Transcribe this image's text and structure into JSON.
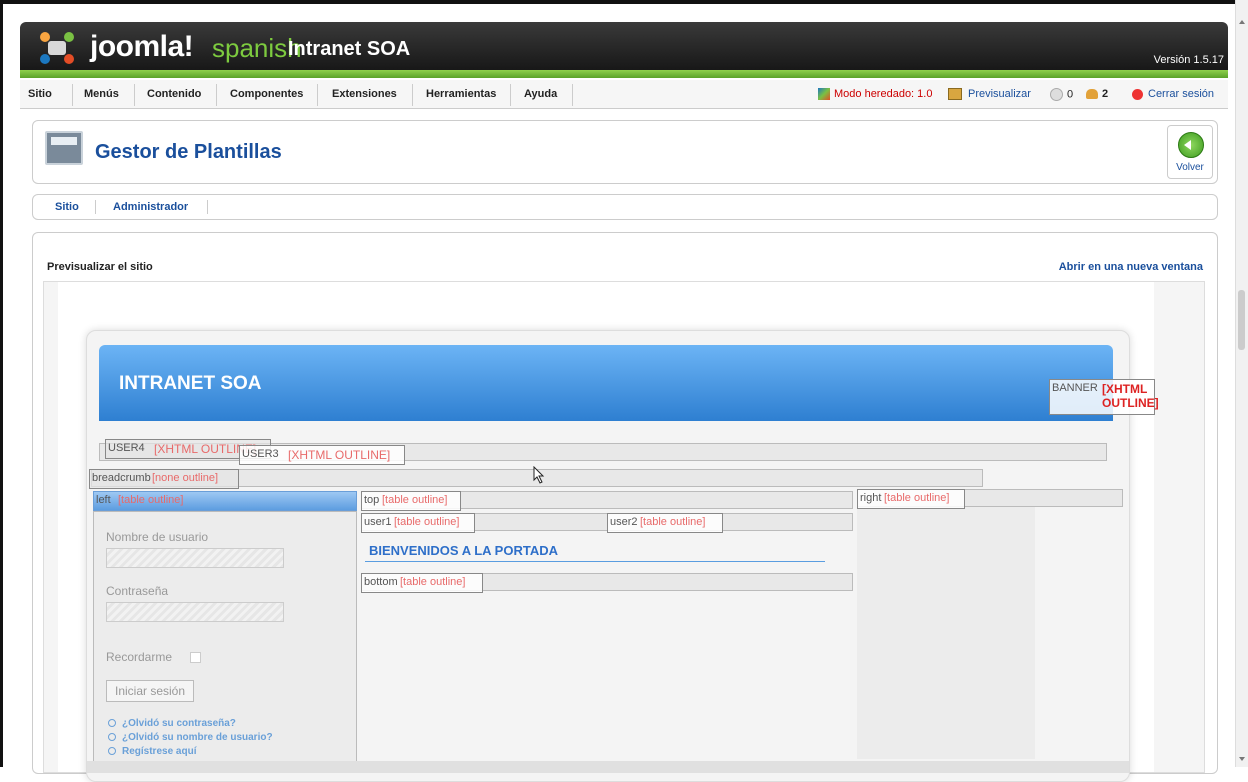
{
  "header": {
    "logo_text": "joomla!",
    "logo_spanish": "spanish",
    "site_name": "Intranet SOA",
    "version": "Versión 1.5.17"
  },
  "menubar": {
    "items": [
      "Sitio",
      "Menús",
      "Contenido",
      "Componentes",
      "Extensiones",
      "Herramientas",
      "Ayuda"
    ],
    "legacy_mode": "Modo heredado: 1.0",
    "preview": "Previsualizar",
    "messages_count": "0",
    "users_count": "2",
    "logout": "Cerrar sesión"
  },
  "page": {
    "title": "Gestor de Plantillas",
    "back_label": "Volver"
  },
  "subnav": {
    "items": [
      "Sitio",
      "Administrador"
    ]
  },
  "preview": {
    "label": "Previsualizar el sitio",
    "open_new_window": "Abrir en una nueva ventana"
  },
  "site": {
    "title": "INTRANET SOA",
    "welcome": "BIENVENIDOS A LA PORTADA",
    "positions": {
      "banner": "BANNER",
      "banner_tag": "[XHTML OUTLINE]",
      "user4": "USER4",
      "user4_tag": "[XHTML OUTLINE]",
      "user3": "USER3",
      "user3_tag": "[XHTML OUTLINE]",
      "breadcrumb": "breadcrumb",
      "breadcrumb_tag": "[none outline]",
      "left": "left",
      "left_tag": "[table outline]",
      "top": "top",
      "top_tag": "[table outline]",
      "right": "right",
      "right_tag": "[table outline]",
      "user1": "user1",
      "user1_tag": "[table outline]",
      "user2": "user2",
      "user2_tag": "[table outline]",
      "bottom": "bottom",
      "bottom_tag": "[table outline]"
    },
    "login": {
      "username_label": "Nombre de usuario",
      "password_label": "Contraseña",
      "remember_label": "Recordarme",
      "login_button": "Iniciar sesión",
      "forgot_password": "¿Olvidó su contraseña?",
      "forgot_username": "¿Olvidó su nombre de usuario?",
      "register": "Regístrese aquí"
    }
  }
}
